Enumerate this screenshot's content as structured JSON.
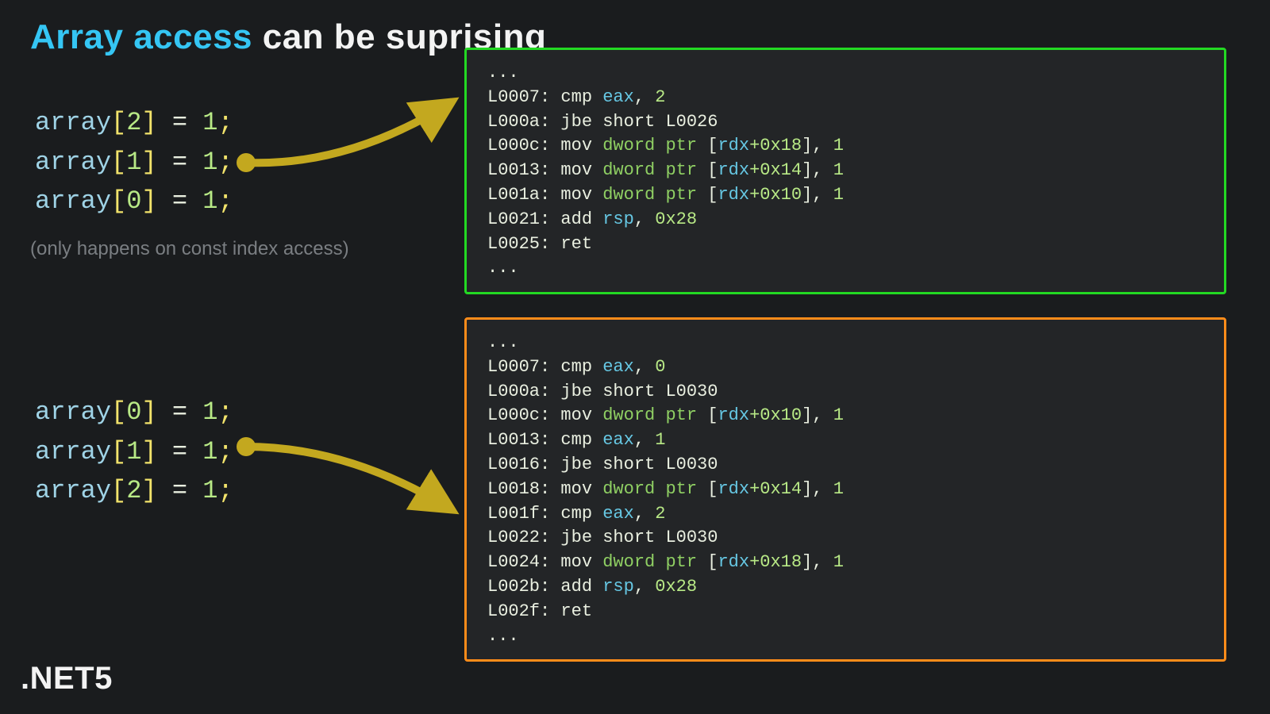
{
  "title": {
    "accent": "Array access",
    "rest": " can be suprising"
  },
  "note": "(only happens on const index access)",
  "footer": ".NET5",
  "code": {
    "upper": [
      {
        "typePrefix": "array",
        "bl": "[",
        "idx": "2",
        "br": "]",
        "eq": " = ",
        "val": "1",
        "sc": ";"
      },
      {
        "typePrefix": "array",
        "bl": "[",
        "idx": "1",
        "br": "]",
        "eq": " = ",
        "val": "1",
        "sc": ";"
      },
      {
        "typePrefix": "array",
        "bl": "[",
        "idx": "0",
        "br": "]",
        "eq": " = ",
        "val": "1",
        "sc": ";"
      }
    ],
    "lower": [
      {
        "typePrefix": "array",
        "bl": "[",
        "idx": "0",
        "br": "]",
        "eq": " = ",
        "val": "1",
        "sc": ";"
      },
      {
        "typePrefix": "array",
        "bl": "[",
        "idx": "1",
        "br": "]",
        "eq": " = ",
        "val": "1",
        "sc": ";"
      },
      {
        "typePrefix": "array",
        "bl": "[",
        "idx": "2",
        "br": "]",
        "eq": " = ",
        "val": "1",
        "sc": ";"
      }
    ]
  },
  "asm": {
    "green": [
      {
        "kind": "ellipsis",
        "text": "..."
      },
      {
        "kind": "cmp",
        "label": "L0007:",
        "mnem": "cmp",
        "reg": "eax",
        "comma": ", ",
        "val": "2"
      },
      {
        "kind": "jbe",
        "label": "L000a:",
        "mnem": "jbe",
        "target": "short L0026"
      },
      {
        "kind": "mov",
        "label": "L000c:",
        "mnem": "mov",
        "kw": "dword ptr",
        "mem": " [",
        "reg": "rdx",
        "off": "+0x18",
        "mem2": "], ",
        "val": "1"
      },
      {
        "kind": "mov",
        "label": "L0013:",
        "mnem": "mov",
        "kw": "dword ptr",
        "mem": " [",
        "reg": "rdx",
        "off": "+0x14",
        "mem2": "], ",
        "val": "1"
      },
      {
        "kind": "mov",
        "label": "L001a:",
        "mnem": "mov",
        "kw": "dword ptr",
        "mem": " [",
        "reg": "rdx",
        "off": "+0x10",
        "mem2": "], ",
        "val": "1"
      },
      {
        "kind": "add",
        "label": "L0021:",
        "mnem": "add",
        "reg": "rsp",
        "comma": ", ",
        "val": "0x28"
      },
      {
        "kind": "ret",
        "label": "L0025:",
        "mnem": "ret"
      },
      {
        "kind": "ellipsis",
        "text": "..."
      }
    ],
    "orange": [
      {
        "kind": "ellipsis",
        "text": "..."
      },
      {
        "kind": "cmp",
        "label": "L0007:",
        "mnem": "cmp",
        "reg": "eax",
        "comma": ", ",
        "val": "0"
      },
      {
        "kind": "jbe",
        "label": "L000a:",
        "mnem": "jbe",
        "target": "short L0030"
      },
      {
        "kind": "mov",
        "label": "L000c:",
        "mnem": "mov",
        "kw": "dword ptr",
        "mem": " [",
        "reg": "rdx",
        "off": "+0x10",
        "mem2": "], ",
        "val": "1"
      },
      {
        "kind": "cmp",
        "label": "L0013:",
        "mnem": "cmp",
        "reg": "eax",
        "comma": ", ",
        "val": "1"
      },
      {
        "kind": "jbe",
        "label": "L0016:",
        "mnem": "jbe",
        "target": "short L0030"
      },
      {
        "kind": "mov",
        "label": "L0018:",
        "mnem": "mov",
        "kw": "dword ptr",
        "mem": " [",
        "reg": "rdx",
        "off": "+0x14",
        "mem2": "], ",
        "val": "1"
      },
      {
        "kind": "cmp",
        "label": "L001f:",
        "mnem": "cmp",
        "reg": "eax",
        "comma": ", ",
        "val": "2"
      },
      {
        "kind": "jbe",
        "label": "L0022:",
        "mnem": "jbe",
        "target": "short L0030"
      },
      {
        "kind": "mov",
        "label": "L0024:",
        "mnem": "mov",
        "kw": "dword ptr",
        "mem": " [",
        "reg": "rdx",
        "off": "+0x18",
        "mem2": "], ",
        "val": "1"
      },
      {
        "kind": "add",
        "label": "L002b:",
        "mnem": "add",
        "reg": "rsp",
        "comma": ", ",
        "val": "0x28"
      },
      {
        "kind": "ret",
        "label": "L002f:",
        "mnem": "ret"
      },
      {
        "kind": "ellipsis",
        "text": "..."
      }
    ]
  },
  "colors": {
    "arrow": "#c3a81f",
    "green": "#23d923",
    "orange": "#ff8c1a",
    "accent": "#35c6f4"
  }
}
